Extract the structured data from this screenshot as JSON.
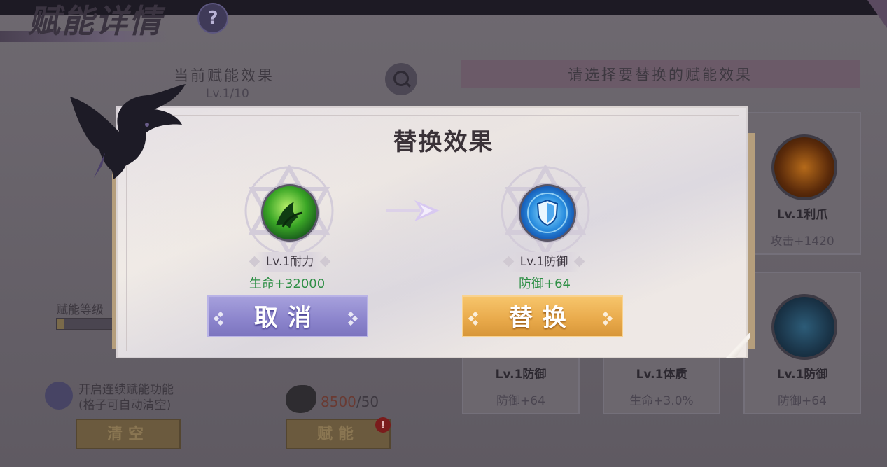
{
  "page": {
    "title": "赋能详情",
    "help_glyph": "?",
    "current_section_title": "当前赋能效果",
    "current_level": "Lv.1/10",
    "right_section_title": "请选择要替换的赋能效果",
    "level_label": "赋能等级",
    "level_progress": 0.1,
    "continuous_toggle_text_line1": "开启连续赋能功能",
    "continuous_toggle_text_line2": "(格子可自动清空)",
    "clear_button": "清空",
    "empower_button": "赋能",
    "cost_have": "8500",
    "cost_sep_need": "/50",
    "alert_glyph": "!"
  },
  "cards": [
    {
      "name": "Lv.1利爪",
      "effect": "攻击+1420",
      "icon": "claw-icon"
    },
    {
      "name": "Lv.1防御",
      "effect": "防御+64",
      "icon": "shield-icon"
    },
    {
      "name": "Lv.1体质",
      "effect": "生命+3.0%",
      "icon": "body-icon"
    },
    {
      "name": "Lv.1防御",
      "effect": "防御+64",
      "icon": "shield-icon"
    }
  ],
  "modal": {
    "title": "替换效果",
    "from": {
      "name": "Lv.1耐力",
      "effect": "生命+32000",
      "icon": "endurance-icon"
    },
    "to": {
      "name": "Lv.1防御",
      "effect": "防御+64",
      "icon": "defense-shield-icon"
    },
    "cancel_label": "取消",
    "confirm_label": "替换",
    "colors": {
      "effect_green": "#2f8f46",
      "cancel_purple": "#8b84cc",
      "confirm_orange": "#e8a94a"
    }
  }
}
